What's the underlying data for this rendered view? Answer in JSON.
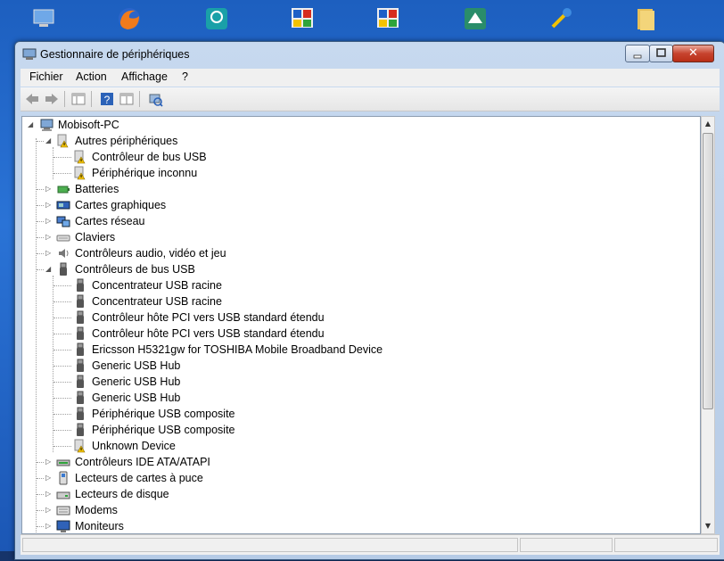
{
  "window": {
    "title": "Gestionnaire de périphériques",
    "close_glyph": "✕"
  },
  "menu": [
    "Fichier",
    "Action",
    "Affichage",
    "?"
  ],
  "tree": {
    "root": "Mobisoft-PC",
    "groups": [
      {
        "label": "Autres périphériques",
        "expanded": true,
        "icon": "warning-device-icon",
        "children": [
          "Contrôleur de bus USB",
          "Périphérique inconnu"
        ],
        "child_icon": "warning-device-icon"
      },
      {
        "label": "Batteries",
        "expanded": false,
        "icon": "battery-icon"
      },
      {
        "label": "Cartes graphiques",
        "expanded": false,
        "icon": "display-adapter-icon"
      },
      {
        "label": "Cartes réseau",
        "expanded": false,
        "icon": "network-adapter-icon"
      },
      {
        "label": "Claviers",
        "expanded": false,
        "icon": "keyboard-icon"
      },
      {
        "label": "Contrôleurs audio, vidéo et jeu",
        "expanded": false,
        "icon": "speaker-icon"
      },
      {
        "label": "Contrôleurs de bus USB",
        "expanded": true,
        "icon": "usb-icon",
        "children": [
          "Concentrateur USB racine",
          "Concentrateur USB racine",
          "Contrôleur hôte PCI vers USB standard étendu",
          "Contrôleur hôte PCI vers USB standard étendu",
          "Ericsson H5321gw for TOSHIBA Mobile Broadband Device",
          "Generic USB Hub",
          "Generic USB Hub",
          "Generic USB Hub",
          "Périphérique USB composite",
          "Périphérique USB composite",
          "Unknown Device"
        ],
        "child_icon": "usb-icon",
        "last_child_icon": "warning-device-icon"
      },
      {
        "label": "Contrôleurs IDE ATA/ATAPI",
        "expanded": false,
        "icon": "ide-controller-icon"
      },
      {
        "label": "Lecteurs de cartes à puce",
        "expanded": false,
        "icon": "smart-card-reader-icon"
      },
      {
        "label": "Lecteurs de disque",
        "expanded": false,
        "icon": "disk-drive-icon"
      },
      {
        "label": "Modems",
        "expanded": false,
        "icon": "modem-icon"
      },
      {
        "label": "Moniteurs",
        "expanded": false,
        "icon": "monitor-icon"
      }
    ]
  },
  "colors": {
    "warning": "#f2c200",
    "usb": "#555555",
    "title_bg": "#c3d6ee",
    "close": "#c7432e"
  }
}
